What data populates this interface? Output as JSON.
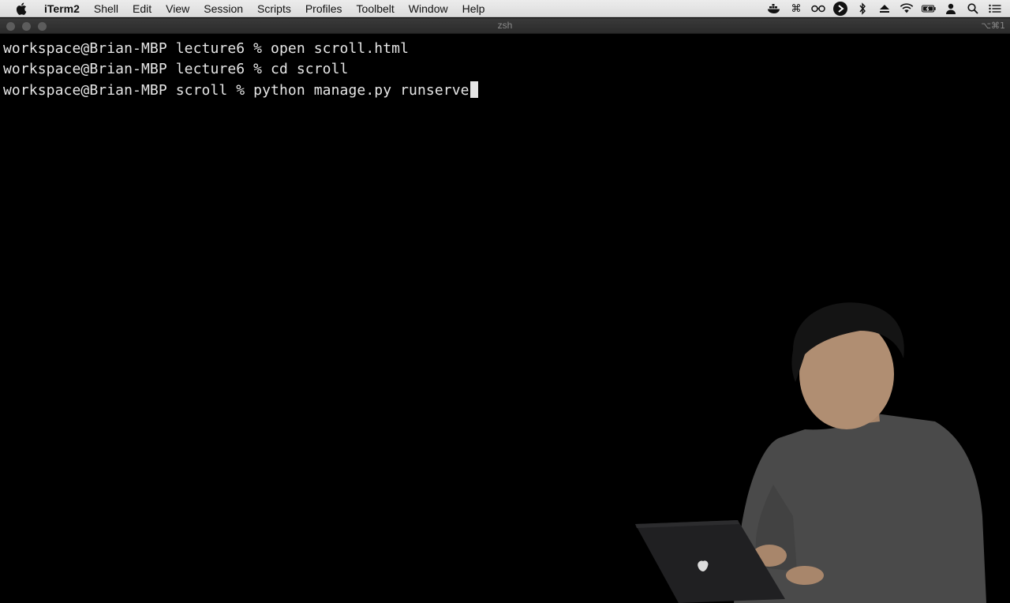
{
  "menubar": {
    "apple_icon": "apple-logo-icon",
    "items": [
      "iTerm2",
      "Shell",
      "Edit",
      "View",
      "Session",
      "Scripts",
      "Profiles",
      "Toolbelt",
      "Window",
      "Help"
    ],
    "status_icons": [
      "docker-icon",
      "command-icon",
      "glasses-icon",
      "play-circle-icon",
      "bluetooth-icon",
      "eject-icon",
      "wifi-icon",
      "battery-charging-icon",
      "user-icon",
      "search-icon",
      "list-icon"
    ]
  },
  "window": {
    "title": "zsh",
    "shortcut": "⌥⌘1"
  },
  "terminal": {
    "lines": [
      "workspace@Brian-MBP lecture6 % open scroll.html",
      "workspace@Brian-MBP lecture6 % cd scroll",
      "workspace@Brian-MBP scroll % python manage.py runserve"
    ]
  }
}
